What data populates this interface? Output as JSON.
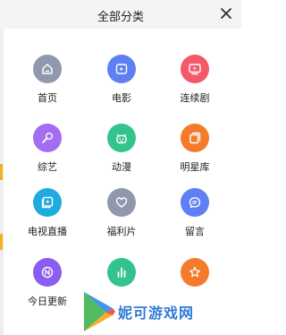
{
  "header": {
    "title": "全部分类",
    "close_icon": "close-icon"
  },
  "accent_yellow": "#f1b51c",
  "categories": [
    {
      "label": "首页",
      "icon": "home-icon",
      "color": "#8f98ad"
    },
    {
      "label": "电影",
      "icon": "movie-play-icon",
      "color": "#5f7ff2"
    },
    {
      "label": "连续剧",
      "icon": "tv-icon",
      "color": "#f25a6b"
    },
    {
      "label": "综艺",
      "icon": "microphone-icon",
      "color": "#a36cf1"
    },
    {
      "label": "动漫",
      "icon": "cartoon-face-icon",
      "color": "#33c38c"
    },
    {
      "label": "明星库",
      "icon": "gallery-icon",
      "color": "#f57b2c"
    },
    {
      "label": "电视直播",
      "icon": "live-tv-icon",
      "color": "#1eabde"
    },
    {
      "label": "福利片",
      "icon": "heart-icon",
      "color": "#8f98ad"
    },
    {
      "label": "留言",
      "icon": "message-icon",
      "color": "#5f7ff2"
    },
    {
      "label": "今日更新",
      "icon": "new-badge-icon",
      "color": "#8a5cf0"
    },
    {
      "label": "",
      "icon": "bar-chart-icon",
      "color": "#33c38c"
    },
    {
      "label": "",
      "icon": "star-icon",
      "color": "#f57b2c"
    }
  ],
  "watermark": {
    "text": "妮可游戏网",
    "icon": "play-logo-icon"
  }
}
